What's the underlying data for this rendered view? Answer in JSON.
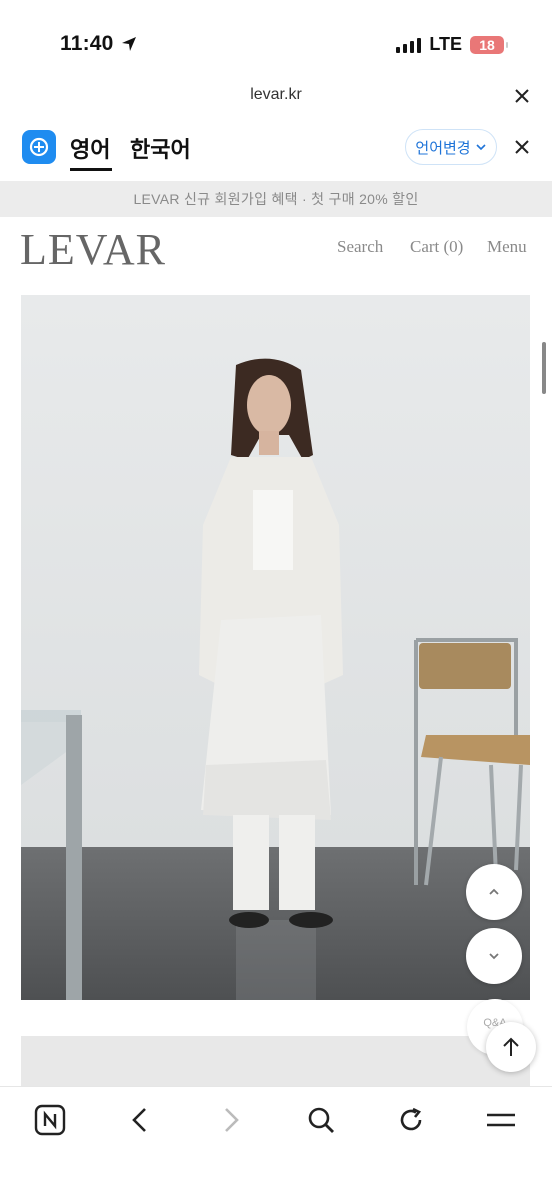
{
  "status": {
    "time": "11:40",
    "network": "LTE",
    "battery": "18"
  },
  "browser": {
    "host": "levar.kr"
  },
  "translate": {
    "tab_english": "영어",
    "tab_korean": "한국어",
    "change_language": "언어변경"
  },
  "site": {
    "banner": "LEVAR 신규 회원가입 혜택 · 첫 구매 20% 할인",
    "logo": "LEVAR",
    "nav": {
      "search": "Search",
      "cart": "Cart (0)",
      "menu": "Menu"
    }
  },
  "floating": {
    "qa_label": "Q&A"
  },
  "icons": {
    "location": "location-arrow-icon",
    "signal": "signal-icon",
    "battery": "battery-icon",
    "translate_logo": "translate-app-icon",
    "scroll_up": "chevron-up-icon",
    "scroll_down": "chevron-down-icon",
    "to_top": "arrow-up-icon",
    "home": "naver-n-icon",
    "back": "chevron-left-icon",
    "forward": "chevron-right-icon",
    "search": "search-icon",
    "reload": "reload-icon",
    "menu": "menu-icon"
  },
  "colors": {
    "accent_blue": "#1f74d8",
    "banner_bg": "#ececec",
    "logo_grey": "#666666"
  }
}
